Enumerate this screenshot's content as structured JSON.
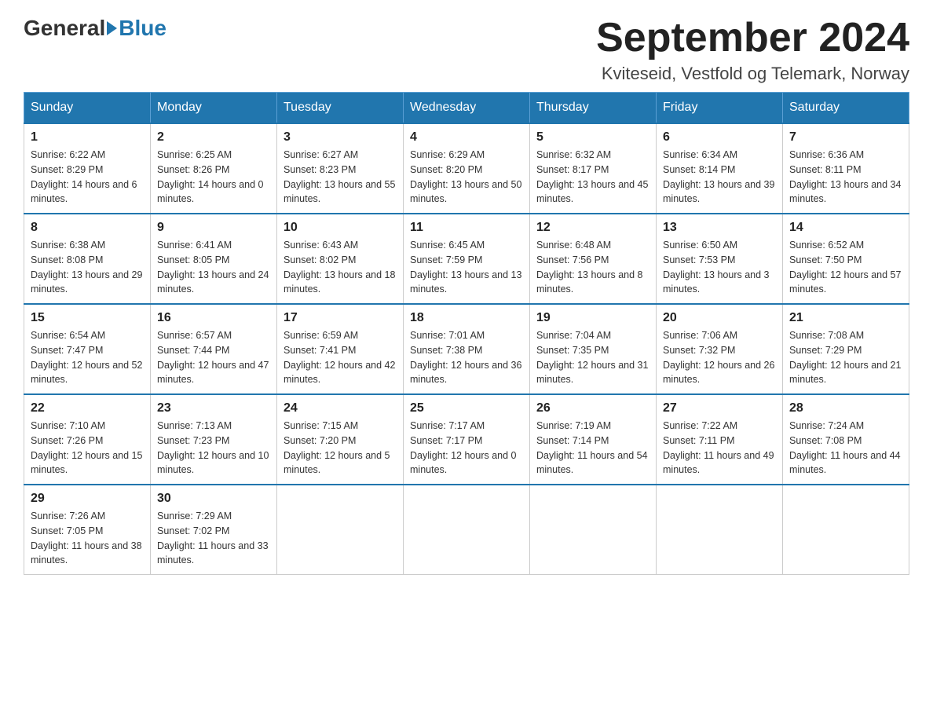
{
  "header": {
    "logo_general": "General",
    "logo_blue": "Blue",
    "title": "September 2024",
    "subtitle": "Kviteseid, Vestfold og Telemark, Norway"
  },
  "calendar": {
    "days_of_week": [
      "Sunday",
      "Monday",
      "Tuesday",
      "Wednesday",
      "Thursday",
      "Friday",
      "Saturday"
    ],
    "weeks": [
      [
        {
          "day": "1",
          "sunrise": "6:22 AM",
          "sunset": "8:29 PM",
          "daylight": "14 hours and 6 minutes."
        },
        {
          "day": "2",
          "sunrise": "6:25 AM",
          "sunset": "8:26 PM",
          "daylight": "14 hours and 0 minutes."
        },
        {
          "day": "3",
          "sunrise": "6:27 AM",
          "sunset": "8:23 PM",
          "daylight": "13 hours and 55 minutes."
        },
        {
          "day": "4",
          "sunrise": "6:29 AM",
          "sunset": "8:20 PM",
          "daylight": "13 hours and 50 minutes."
        },
        {
          "day": "5",
          "sunrise": "6:32 AM",
          "sunset": "8:17 PM",
          "daylight": "13 hours and 45 minutes."
        },
        {
          "day": "6",
          "sunrise": "6:34 AM",
          "sunset": "8:14 PM",
          "daylight": "13 hours and 39 minutes."
        },
        {
          "day": "7",
          "sunrise": "6:36 AM",
          "sunset": "8:11 PM",
          "daylight": "13 hours and 34 minutes."
        }
      ],
      [
        {
          "day": "8",
          "sunrise": "6:38 AM",
          "sunset": "8:08 PM",
          "daylight": "13 hours and 29 minutes."
        },
        {
          "day": "9",
          "sunrise": "6:41 AM",
          "sunset": "8:05 PM",
          "daylight": "13 hours and 24 minutes."
        },
        {
          "day": "10",
          "sunrise": "6:43 AM",
          "sunset": "8:02 PM",
          "daylight": "13 hours and 18 minutes."
        },
        {
          "day": "11",
          "sunrise": "6:45 AM",
          "sunset": "7:59 PM",
          "daylight": "13 hours and 13 minutes."
        },
        {
          "day": "12",
          "sunrise": "6:48 AM",
          "sunset": "7:56 PM",
          "daylight": "13 hours and 8 minutes."
        },
        {
          "day": "13",
          "sunrise": "6:50 AM",
          "sunset": "7:53 PM",
          "daylight": "13 hours and 3 minutes."
        },
        {
          "day": "14",
          "sunrise": "6:52 AM",
          "sunset": "7:50 PM",
          "daylight": "12 hours and 57 minutes."
        }
      ],
      [
        {
          "day": "15",
          "sunrise": "6:54 AM",
          "sunset": "7:47 PM",
          "daylight": "12 hours and 52 minutes."
        },
        {
          "day": "16",
          "sunrise": "6:57 AM",
          "sunset": "7:44 PM",
          "daylight": "12 hours and 47 minutes."
        },
        {
          "day": "17",
          "sunrise": "6:59 AM",
          "sunset": "7:41 PM",
          "daylight": "12 hours and 42 minutes."
        },
        {
          "day": "18",
          "sunrise": "7:01 AM",
          "sunset": "7:38 PM",
          "daylight": "12 hours and 36 minutes."
        },
        {
          "day": "19",
          "sunrise": "7:04 AM",
          "sunset": "7:35 PM",
          "daylight": "12 hours and 31 minutes."
        },
        {
          "day": "20",
          "sunrise": "7:06 AM",
          "sunset": "7:32 PM",
          "daylight": "12 hours and 26 minutes."
        },
        {
          "day": "21",
          "sunrise": "7:08 AM",
          "sunset": "7:29 PM",
          "daylight": "12 hours and 21 minutes."
        }
      ],
      [
        {
          "day": "22",
          "sunrise": "7:10 AM",
          "sunset": "7:26 PM",
          "daylight": "12 hours and 15 minutes."
        },
        {
          "day": "23",
          "sunrise": "7:13 AM",
          "sunset": "7:23 PM",
          "daylight": "12 hours and 10 minutes."
        },
        {
          "day": "24",
          "sunrise": "7:15 AM",
          "sunset": "7:20 PM",
          "daylight": "12 hours and 5 minutes."
        },
        {
          "day": "25",
          "sunrise": "7:17 AM",
          "sunset": "7:17 PM",
          "daylight": "12 hours and 0 minutes."
        },
        {
          "day": "26",
          "sunrise": "7:19 AM",
          "sunset": "7:14 PM",
          "daylight": "11 hours and 54 minutes."
        },
        {
          "day": "27",
          "sunrise": "7:22 AM",
          "sunset": "7:11 PM",
          "daylight": "11 hours and 49 minutes."
        },
        {
          "day": "28",
          "sunrise": "7:24 AM",
          "sunset": "7:08 PM",
          "daylight": "11 hours and 44 minutes."
        }
      ],
      [
        {
          "day": "29",
          "sunrise": "7:26 AM",
          "sunset": "7:05 PM",
          "daylight": "11 hours and 38 minutes."
        },
        {
          "day": "30",
          "sunrise": "7:29 AM",
          "sunset": "7:02 PM",
          "daylight": "11 hours and 33 minutes."
        },
        null,
        null,
        null,
        null,
        null
      ]
    ],
    "labels": {
      "sunrise": "Sunrise:",
      "sunset": "Sunset:",
      "daylight": "Daylight:"
    }
  }
}
